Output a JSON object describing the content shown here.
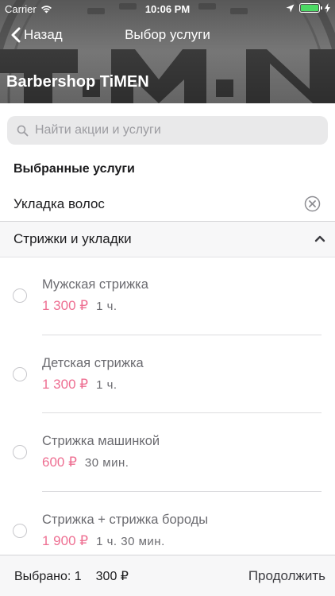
{
  "status_bar": {
    "carrier": "Carrier",
    "time": "10:06 PM",
    "battery_level": 1.0
  },
  "nav": {
    "back_label": "Назад",
    "title": "Выбор услуги"
  },
  "hero": {
    "shop_name": "Barbershop TiMEN",
    "background_lettering": "T.M.N"
  },
  "search": {
    "placeholder": "Найти акции и услуги",
    "value": ""
  },
  "selected": {
    "heading": "Выбранные услуги",
    "items": [
      {
        "label": "Укладка волос"
      }
    ]
  },
  "category": {
    "label": "Стрижки и укладки",
    "expanded": true,
    "services": [
      {
        "name": "Мужская стрижка",
        "price": "1 300 ₽",
        "duration": "1 ч.",
        "selected": false
      },
      {
        "name": "Детская стрижка",
        "price": "1 300 ₽",
        "duration": "1 ч.",
        "selected": false
      },
      {
        "name": "Стрижка машинкой",
        "price": "600 ₽",
        "duration": "30 мин.",
        "selected": false
      },
      {
        "name": "Стрижка + стрижка бороды",
        "price": "1 900 ₽",
        "duration": "1 ч. 30 мин.",
        "selected": false
      }
    ]
  },
  "bottom_bar": {
    "selected_label": "Выбрано: 1",
    "total": "300 ₽",
    "continue_label": "Продолжить"
  },
  "colors": {
    "price_accent": "#ee6f92",
    "battery": "#4cd964",
    "hero_background": "#7b7b7b"
  },
  "icons": {
    "back": "chevron-left-icon",
    "search": "search-icon",
    "remove": "clear-circle-icon",
    "collapse": "chevron-up-icon",
    "wifi": "wifi-icon",
    "location": "location-arrow-icon",
    "charging": "charging-bolt-icon"
  }
}
